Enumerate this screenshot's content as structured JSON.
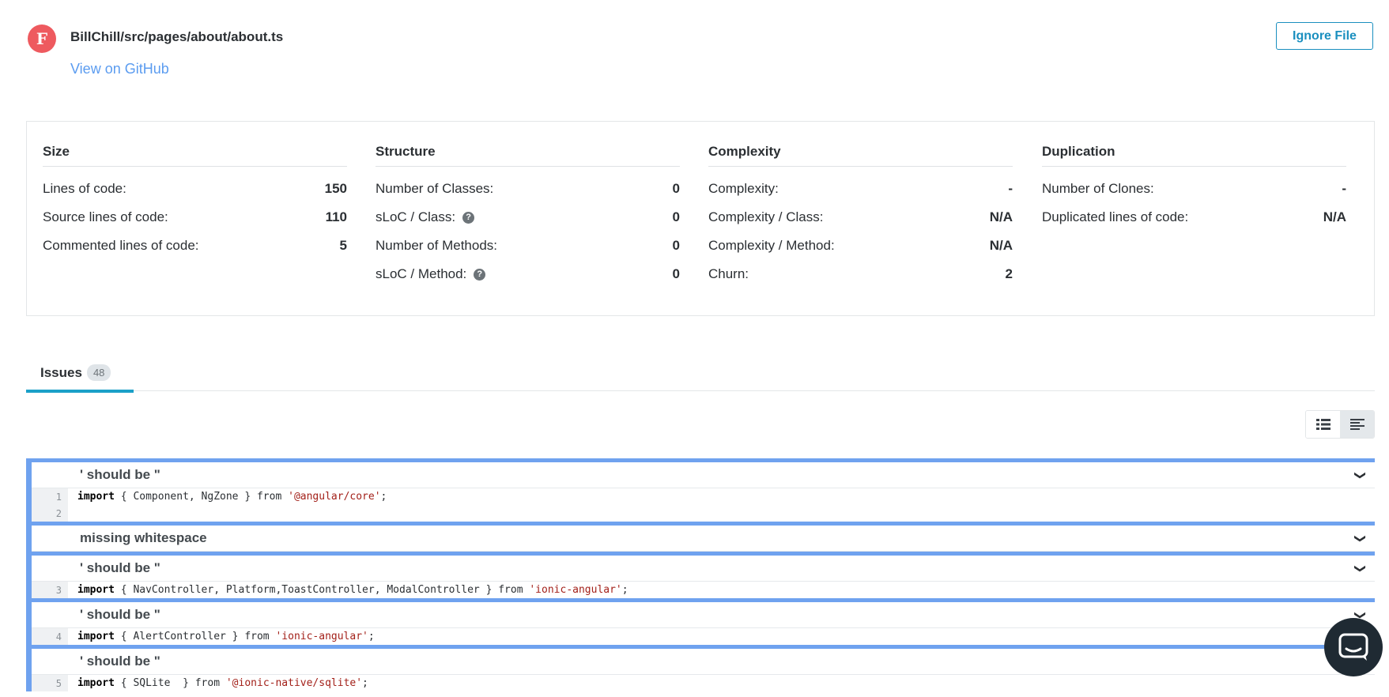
{
  "header": {
    "grade": "F",
    "file_path": "BillChill/src/pages/about/about.ts",
    "github_link": "View on GitHub",
    "ignore_button": "Ignore File"
  },
  "metrics": {
    "size": {
      "title": "Size",
      "rows": [
        {
          "label": "Lines of code:",
          "value": "150"
        },
        {
          "label": "Source lines of code:",
          "value": "110"
        },
        {
          "label": "Commented lines of code:",
          "value": "5"
        }
      ]
    },
    "structure": {
      "title": "Structure",
      "rows": [
        {
          "label": "Number of Classes:",
          "value": "0"
        },
        {
          "label": "sLoC / Class:",
          "value": "0",
          "help": true
        },
        {
          "label": "Number of Methods:",
          "value": "0"
        },
        {
          "label": "sLoC / Method:",
          "value": "0",
          "help": true
        }
      ]
    },
    "complexity": {
      "title": "Complexity",
      "rows": [
        {
          "label": "Complexity:",
          "value": "-"
        },
        {
          "label": "Complexity / Class:",
          "value": "N/A"
        },
        {
          "label": "Complexity / Method:",
          "value": "N/A"
        },
        {
          "label": "Churn:",
          "value": "2"
        }
      ]
    },
    "duplication": {
      "title": "Duplication",
      "rows": [
        {
          "label": "Number of Clones:",
          "value": "-"
        },
        {
          "label": "Duplicated lines of code:",
          "value": "N/A"
        }
      ]
    }
  },
  "tabs": {
    "issues_label": "Issues",
    "issues_count": "48"
  },
  "issues": [
    {
      "title": "' should be \"",
      "lines": [
        {
          "num": "1",
          "code": [
            [
              "kw",
              "import"
            ],
            [
              "",
              "{ Component, NgZone } from "
            ],
            [
              "str",
              "'@angular/core'"
            ],
            [
              "",
              ";"
            ]
          ]
        },
        {
          "num": "2",
          "code": []
        }
      ]
    },
    {
      "title": "missing whitespace",
      "lines": []
    },
    {
      "title": "' should be \"",
      "lines": [
        {
          "num": "3",
          "code": [
            [
              "kw",
              "import"
            ],
            [
              "",
              "{ NavController, Platform,ToastController, ModalController } from "
            ],
            [
              "str",
              "'ionic-angular'"
            ],
            [
              "",
              ";"
            ]
          ]
        }
      ]
    },
    {
      "title": "' should be \"",
      "lines": [
        {
          "num": "4",
          "code": [
            [
              "kw",
              "import"
            ],
            [
              "",
              "{ AlertController } from "
            ],
            [
              "str",
              "'ionic-angular'"
            ],
            [
              "",
              ";"
            ]
          ]
        }
      ]
    },
    {
      "title": "' should be \"",
      "lines": [
        {
          "num": "5",
          "code": [
            [
              "kw",
              "import"
            ],
            [
              "",
              "{ SQLite  } from "
            ],
            [
              "str",
              "'@ionic-native/sqlite'"
            ],
            [
              "",
              ";"
            ]
          ]
        }
      ]
    }
  ]
}
